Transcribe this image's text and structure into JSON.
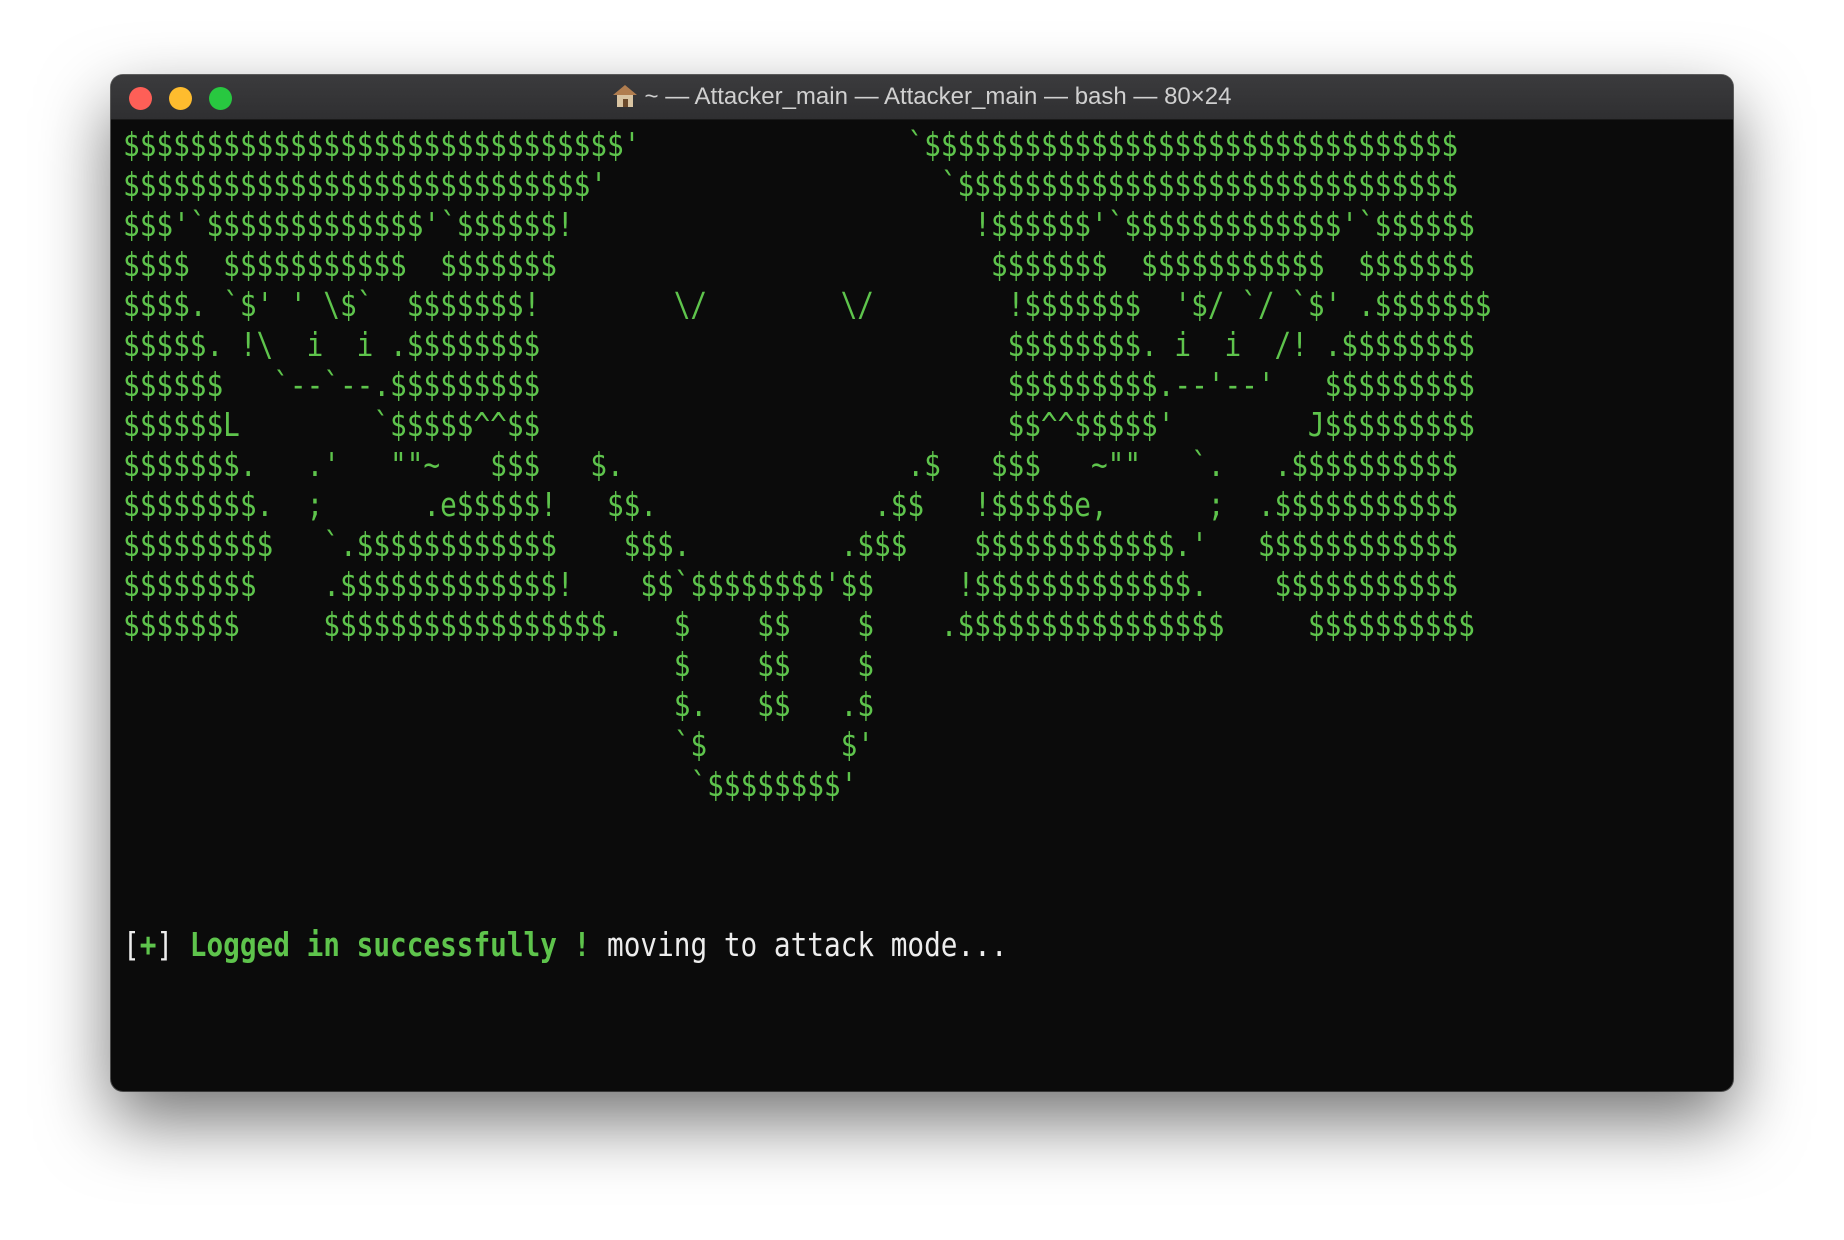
{
  "window": {
    "title": "~ — Attacker_main — Attacker_main — bash — 80×24",
    "traffic_lights": {
      "close_color": "#fe5f57",
      "minimize_color": "#febc2e",
      "zoom_color": "#28c840"
    },
    "title_icon": "home-folder-icon"
  },
  "terminal": {
    "text_color": "#5ec44c",
    "background": "#0b0b0b",
    "ascii_art": [
      "$$$$$$$$$$$$$$$$$$$$$$$$$$$$$$'                `$$$$$$$$$$$$$$$$$$$$$$$$$$$$$$$$",
      "$$$$$$$$$$$$$$$$$$$$$$$$$$$$'                    `$$$$$$$$$$$$$$$$$$$$$$$$$$$$$$",
      "$$$'`$$$$$$$$$$$$$'`$$$$$$!                        !$$$$$$'`$$$$$$$$$$$$$'`$$$$$$",
      "$$$$  $$$$$$$$$$$  $$$$$$$                          $$$$$$$  $$$$$$$$$$$  $$$$$$$",
      "$$$$. `$' ' \\$`  $$$$$$$!        \\/        \\/        !$$$$$$$  '$/ `/ `$' .$$$$$$$",
      "$$$$$. !\\  i  i .$$$$$$$$                            $$$$$$$$. i  i  /! .$$$$$$$$",
      "$$$$$$   `--`--.$$$$$$$$$                            $$$$$$$$$.--'--'   $$$$$$$$$",
      "$$$$$$L        `$$$$$^^$$                            $$^^$$$$$'        J$$$$$$$$$",
      "$$$$$$$.   .'   \"\"~   $$$   $.                 .$   $$$   ~\"\"   `.   .$$$$$$$$$$",
      "$$$$$$$$.  ;      .e$$$$$!   $$.             .$$   !$$$$$e,      ;  .$$$$$$$$$$$",
      "$$$$$$$$$   `.$$$$$$$$$$$$    $$$.         .$$$    $$$$$$$$$$$$.'   $$$$$$$$$$$$",
      "$$$$$$$$    .$$$$$$$$$$$$$!    $$`$$$$$$$$'$$     !$$$$$$$$$$$$$.    $$$$$$$$$$$",
      "$$$$$$$     $$$$$$$$$$$$$$$$$.   $    $$    $    .$$$$$$$$$$$$$$$$     $$$$$$$$$$",
      "                                 $    $$    $",
      "                                 $.   $$   .$",
      "                                 `$        $'",
      "                                  `$$$$$$$$'"
    ],
    "status_line": {
      "bracket_open": "[",
      "plus": "+",
      "bracket_close": "] ",
      "message": "Logged in successfully !",
      "tail": " moving to attack mode..."
    }
  }
}
